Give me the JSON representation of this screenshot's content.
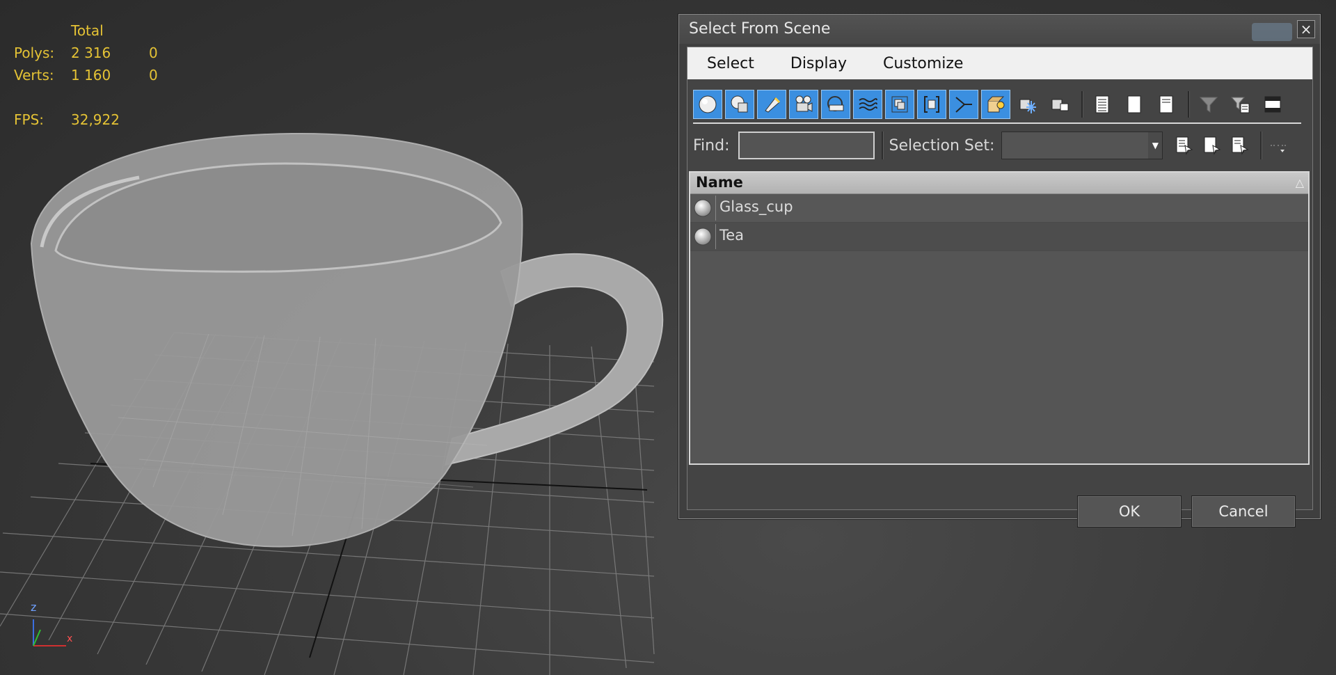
{
  "viewport": {
    "stats": {
      "header": "Total",
      "polys_label": "Polys:",
      "polys_total": "2 316",
      "polys_selected": "0",
      "verts_label": "Verts:",
      "verts_total": "1 160",
      "verts_selected": "0",
      "fps_label": "FPS:",
      "fps_value": "32,922"
    },
    "axis": {
      "z": "z",
      "x": "x"
    },
    "object": "teacup"
  },
  "dialog": {
    "title": "Select From Scene",
    "close_label": "×",
    "menu": [
      "Select",
      "Display",
      "Customize"
    ],
    "toolbar_icons": [
      "display-geometry-icon",
      "display-shapes-icon",
      "display-lights-icon",
      "display-cameras-icon",
      "display-helpers-icon",
      "display-spacewarps-icon",
      "display-groups-icon",
      "display-xrefs-icon",
      "display-bones-icon",
      "display-containers-icon",
      "display-frozen-icon",
      "display-hidden-icon",
      "display-all-icon",
      "display-none-icon",
      "display-invert-icon",
      "filter-icon",
      "sync-selection-icon",
      "select-dependents-icon"
    ],
    "find_label": "Find:",
    "find_value": "",
    "selection_set_label": "Selection Set:",
    "selection_set_value": "",
    "list": {
      "column_name": "Name",
      "sort_glyph": "△",
      "rows": [
        {
          "label": "Glass_cup",
          "icon": "geometry-sphere-icon"
        },
        {
          "label": "Tea",
          "icon": "geometry-sphere-icon"
        }
      ]
    },
    "ok_label": "OK",
    "cancel_label": "Cancel",
    "accent_color": "#3b8fe0"
  }
}
